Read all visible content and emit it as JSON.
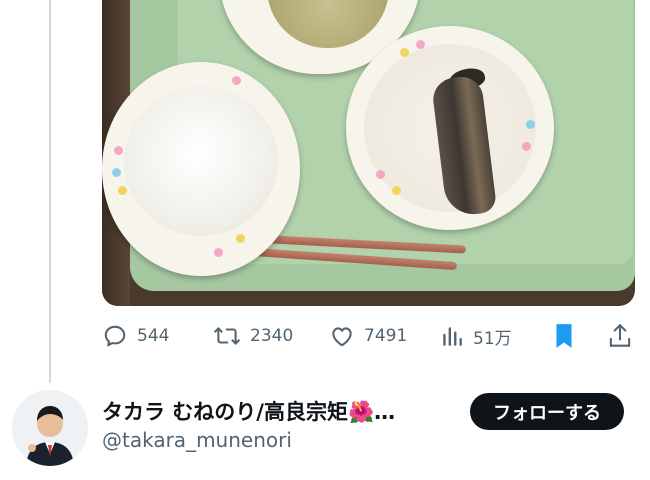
{
  "tweet": {
    "photo": {
      "alt": "school lunch: rice, soup, simmered fish"
    },
    "actions": {
      "replies": "544",
      "retweets": "2340",
      "likes": "7491",
      "views": "51万",
      "bookmarked": true
    }
  },
  "user": {
    "display_name": "タカラ むねのり/高良宗矩🌺…",
    "handle": "@takara_munenori",
    "follow_label": "フォローする"
  },
  "colors": {
    "accent": "#1d9bf0",
    "text_secondary": "#536471",
    "follow_bg": "#0f1419"
  },
  "icons": [
    "reply-icon",
    "retweet-icon",
    "like-icon",
    "views-icon",
    "bookmark-icon",
    "share-icon"
  ]
}
